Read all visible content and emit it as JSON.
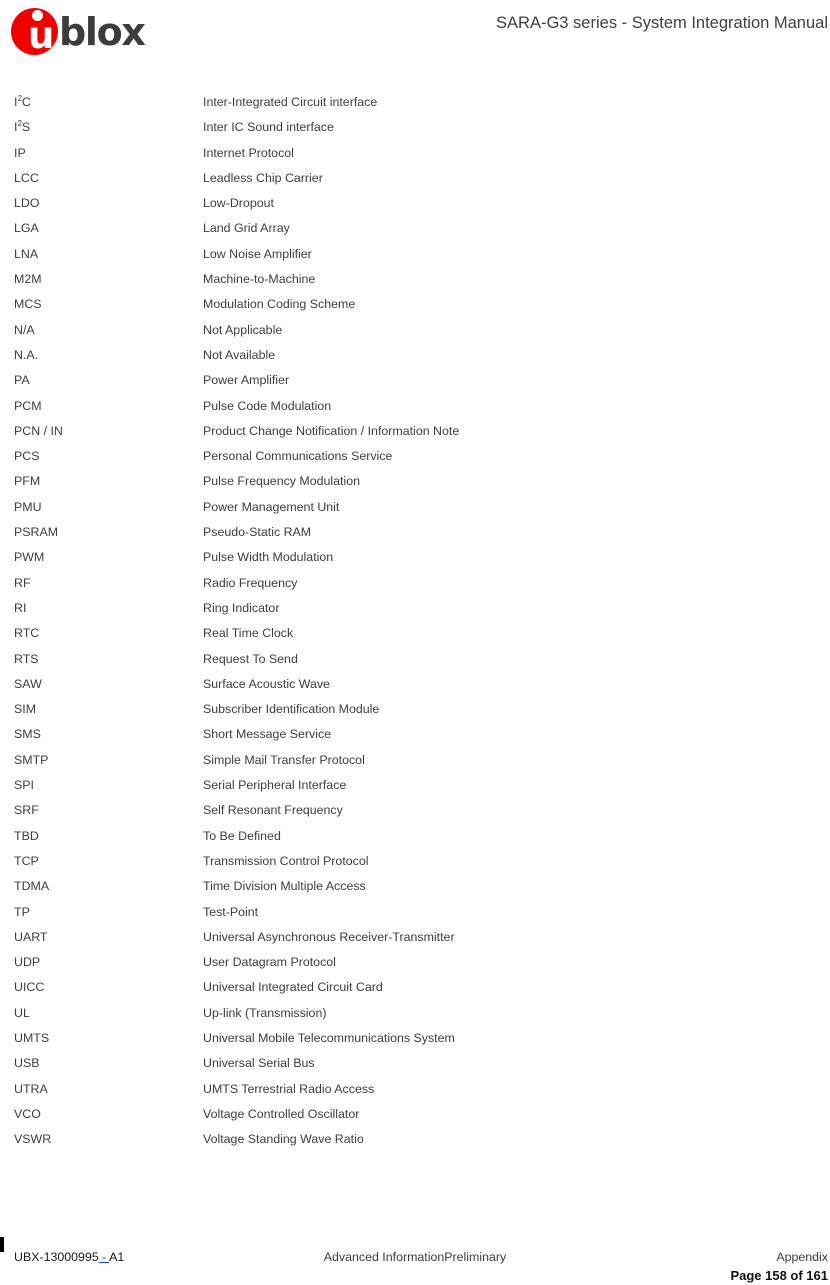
{
  "header": {
    "logo": {
      "icon": "ublox-logo",
      "letter": "u",
      "wordmark": "blox",
      "circle_color": "#ee0000",
      "wordmark_color": "#3c3c3c"
    },
    "title": "SARA-G3 series - System Integration Manual"
  },
  "glossary": {
    "rows": [
      {
        "term": "I",
        "term_sup": "2",
        "term_tail": "C",
        "definition": "Inter-Integrated Circuit interface"
      },
      {
        "term": "I",
        "term_sup": "2",
        "term_tail": "S",
        "definition": "Inter IC Sound interface"
      },
      {
        "term": "IP",
        "definition": "Internet Protocol"
      },
      {
        "term": "LCC",
        "definition": "Leadless Chip Carrier"
      },
      {
        "term": "LDO",
        "definition": "Low-Dropout"
      },
      {
        "term": "LGA",
        "definition": "Land Grid Array"
      },
      {
        "term": "LNA",
        "definition": "Low Noise Amplifier"
      },
      {
        "term": "M2M",
        "definition": "Machine-to-Machine"
      },
      {
        "term": "MCS",
        "definition": "Modulation Coding Scheme"
      },
      {
        "term": "N/A",
        "definition": "Not Applicable"
      },
      {
        "term": "N.A.",
        "definition": "Not Available"
      },
      {
        "term": "PA",
        "definition": "Power Amplifier"
      },
      {
        "term": "PCM",
        "definition": "Pulse Code Modulation"
      },
      {
        "term": "PCN / IN",
        "definition": "Product Change Notification / Information Note"
      },
      {
        "term": "PCS",
        "definition": "Personal Communications Service"
      },
      {
        "term": "PFM",
        "definition": "Pulse Frequency Modulation"
      },
      {
        "term": "PMU",
        "definition": "Power Management Unit"
      },
      {
        "term": "PSRAM",
        "definition": "Pseudo-Static RAM"
      },
      {
        "term": "PWM",
        "definition": "Pulse Width Modulation"
      },
      {
        "term": "RF",
        "definition": "Radio Frequency"
      },
      {
        "term": "RI",
        "definition": "Ring Indicator"
      },
      {
        "term": "RTC",
        "definition": "Real Time Clock"
      },
      {
        "term": "RTS",
        "definition": "Request To Send"
      },
      {
        "term": "SAW",
        "definition": "Surface Acoustic Wave"
      },
      {
        "term": "SIM",
        "definition": "Subscriber Identification Module"
      },
      {
        "term": "SMS",
        "definition": "Short Message Service"
      },
      {
        "term": "SMTP",
        "definition": "Simple Mail Transfer Protocol"
      },
      {
        "term": "SPI",
        "definition": "Serial Peripheral Interface"
      },
      {
        "term": "SRF",
        "definition": "Self Resonant Frequency"
      },
      {
        "term": "TBD",
        "definition": "To Be Defined"
      },
      {
        "term": "TCP",
        "definition": "Transmission Control Protocol"
      },
      {
        "term": "TDMA",
        "definition": "Time Division Multiple Access"
      },
      {
        "term": "TP",
        "definition": "Test-Point"
      },
      {
        "term": "UART",
        "definition": "Universal Asynchronous Receiver-Transmitter"
      },
      {
        "term": "UDP",
        "definition": "User Datagram Protocol"
      },
      {
        "term": "UICC",
        "definition": "Universal Integrated Circuit Card"
      },
      {
        "term": "UL",
        "definition": "Up-link (Transmission)"
      },
      {
        "term": "UMTS",
        "definition": "Universal Mobile Telecommunications System"
      },
      {
        "term": "USB",
        "definition": "Universal Serial Bus"
      },
      {
        "term": "UTRA",
        "definition": "UMTS Terrestrial Radio Access"
      },
      {
        "term": "VCO",
        "definition": "Voltage Controlled Oscillator"
      },
      {
        "term": "VSWR",
        "definition": "Voltage Standing Wave Ratio"
      }
    ]
  },
  "footer": {
    "doc_number": "UBX-13000995",
    "link_dash": " - ",
    "revision": "A1",
    "status": "Advanced InformationPreliminary",
    "section": "Appendix",
    "page": "Page 158 of 161",
    "link_color": "#1f3fd0"
  }
}
